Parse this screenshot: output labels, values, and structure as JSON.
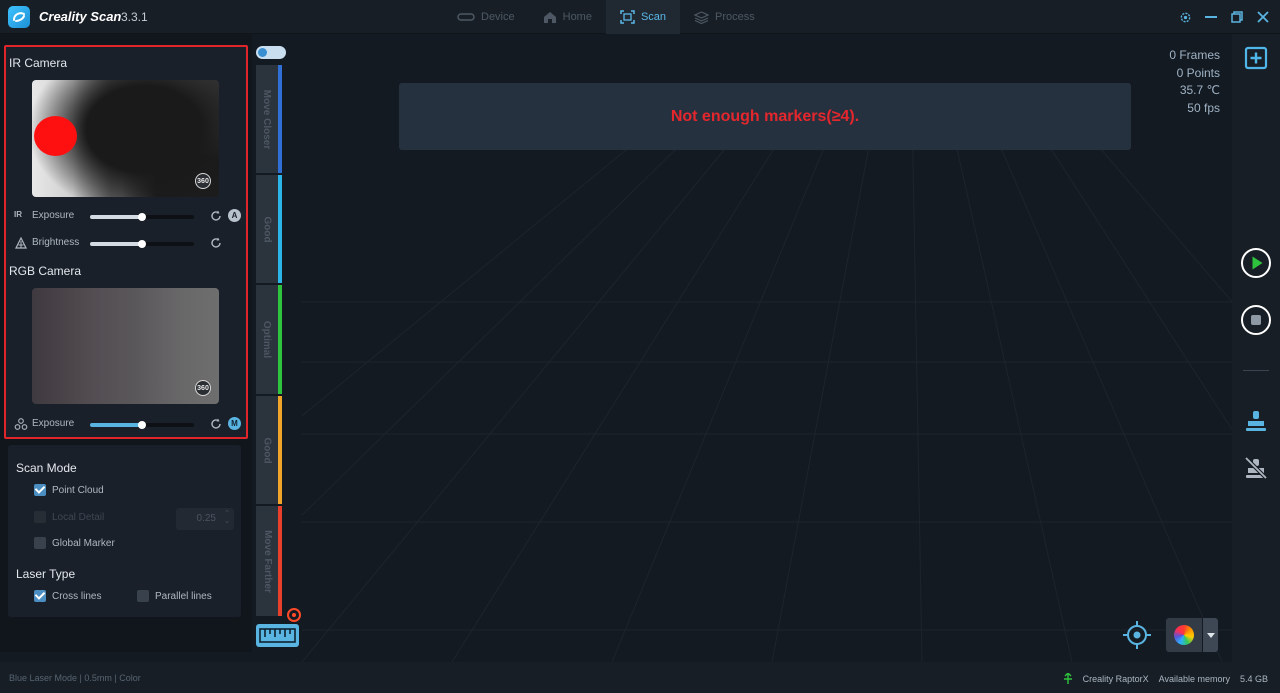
{
  "app": {
    "name": "Creality Scan",
    "version": "3.3.1"
  },
  "nav": {
    "tabs": [
      {
        "label": "Device",
        "icon": "device-icon",
        "active": false
      },
      {
        "label": "Home",
        "icon": "home-icon",
        "active": false
      },
      {
        "label": "Scan",
        "icon": "scan-icon",
        "active": true
      },
      {
        "label": "Process",
        "icon": "process-icon",
        "active": false
      }
    ]
  },
  "ir_camera": {
    "title": "IR Camera",
    "exposure_label": "Exposure",
    "exposure_icon_text": "IR",
    "exposure_level": 0.5,
    "exposure_mode": "A",
    "brightness_label": "Brightness",
    "brightness_level": 0.5
  },
  "rgb_camera": {
    "title": "RGB Camera",
    "exposure_label": "Exposure",
    "exposure_level": 0.5,
    "exposure_mode": "M"
  },
  "scan_mode": {
    "title": "Scan Mode",
    "point_cloud": {
      "label": "Point Cloud",
      "checked": true
    },
    "local_detail": {
      "label": "Local Detail",
      "checked": false,
      "disabled": true,
      "value": "0.25"
    },
    "global_marker": {
      "label": "Global Marker",
      "checked": false
    }
  },
  "laser_type": {
    "title": "Laser Type",
    "cross_lines": {
      "label": "Cross lines",
      "checked": true
    },
    "parallel_lines": {
      "label": "Parallel lines",
      "checked": false
    }
  },
  "distance_gauge": {
    "segments": [
      {
        "label": "Move Closer",
        "color": "#2f6fd6"
      },
      {
        "label": "Good",
        "color": "#2bb5e8"
      },
      {
        "label": "Optimal",
        "color": "#2ec43d"
      },
      {
        "label": "Good",
        "color": "#f0a52a"
      },
      {
        "label": "Move Farther",
        "color": "#e8402a"
      }
    ]
  },
  "viewport": {
    "alert": "Not enough markers(≥4).",
    "stats": {
      "frames": "0 Frames",
      "points": "0 Points",
      "temperature": "35.7 ℃",
      "fps": "50 fps"
    }
  },
  "status": {
    "left": "Blue Laser Mode | 0.5mm | Color",
    "device": "Creality RaptorX",
    "memory_label": "Available memory",
    "memory_value": "5.4 GB"
  },
  "colors": {
    "accent": "#5ab4e2",
    "alert": "#e4262d",
    "highlight_border": "#e0262b",
    "play": "#2ec43d"
  }
}
